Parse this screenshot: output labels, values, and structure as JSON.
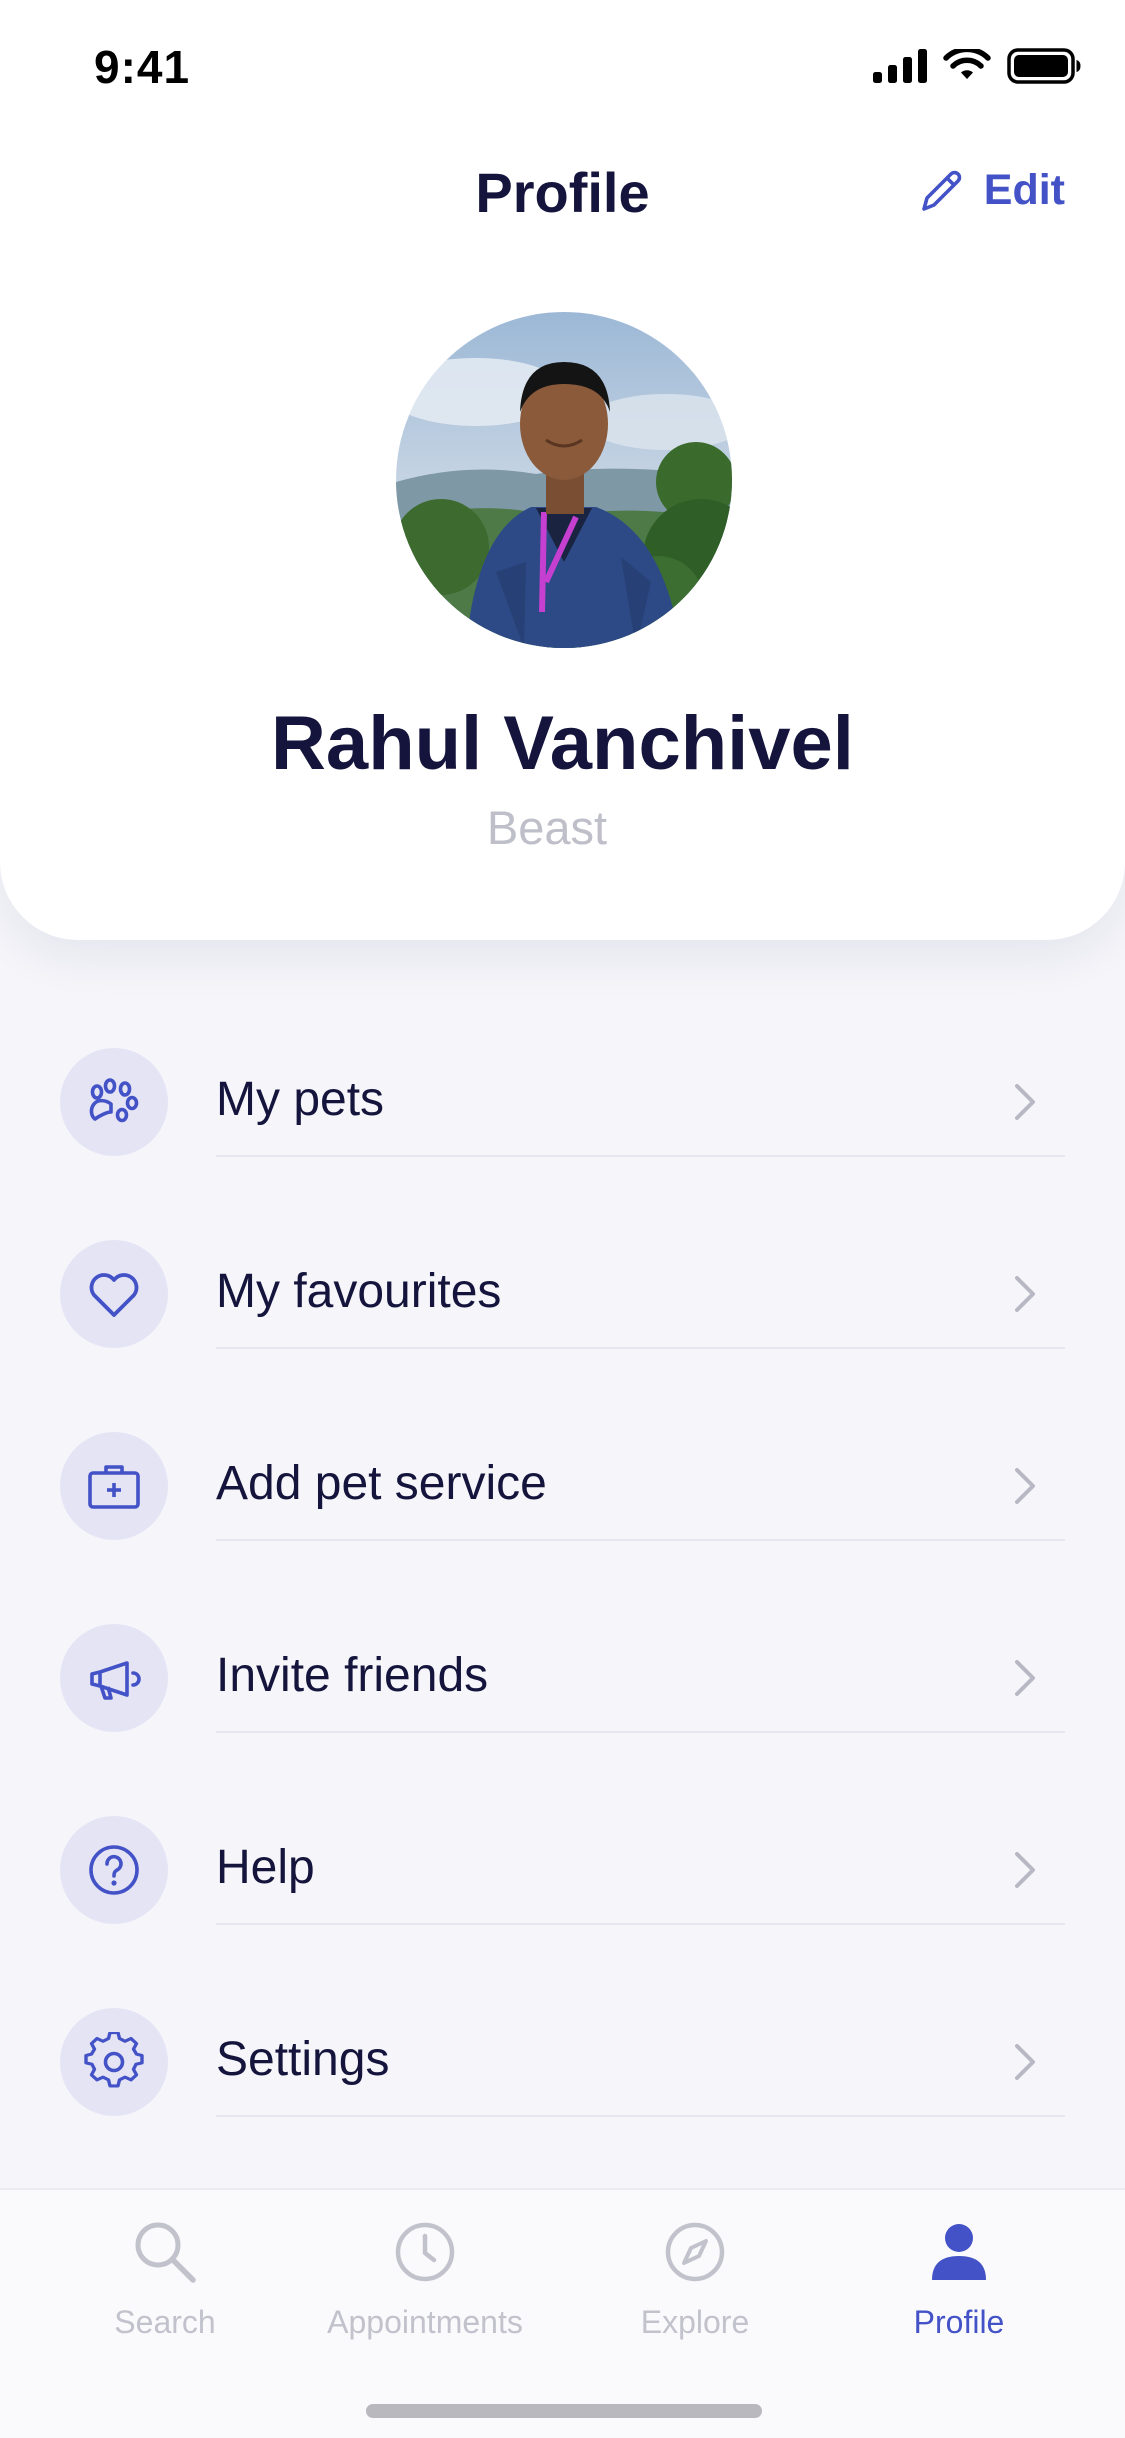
{
  "status_bar": {
    "time": "9:41"
  },
  "header": {
    "title": "Profile",
    "edit_label": "Edit"
  },
  "profile": {
    "name": "Rahul Vanchivel",
    "subtitle": "Beast"
  },
  "menu": {
    "items": [
      {
        "label": "My pets",
        "icon": "paw-icon"
      },
      {
        "label": "My favourites",
        "icon": "heart-icon"
      },
      {
        "label": "Add pet service",
        "icon": "medical-kit-icon"
      },
      {
        "label": "Invite friends",
        "icon": "megaphone-icon"
      },
      {
        "label": "Help",
        "icon": "help-circle-icon"
      },
      {
        "label": "Settings",
        "icon": "gear-icon"
      }
    ]
  },
  "tab_bar": {
    "tabs": [
      {
        "label": "Search",
        "icon": "search-icon",
        "active": false
      },
      {
        "label": "Appointments",
        "icon": "clock-icon",
        "active": false
      },
      {
        "label": "Explore",
        "icon": "compass-icon",
        "active": false
      },
      {
        "label": "Profile",
        "icon": "person-icon",
        "active": true
      }
    ]
  },
  "colors": {
    "accent": "#4352C6",
    "text_primary": "#14143C",
    "text_muted": "#BFBFC9",
    "background": "#F5F5FA",
    "icon_circle": "#E4E4F5",
    "tab_inactive": "#C2C2CC"
  }
}
